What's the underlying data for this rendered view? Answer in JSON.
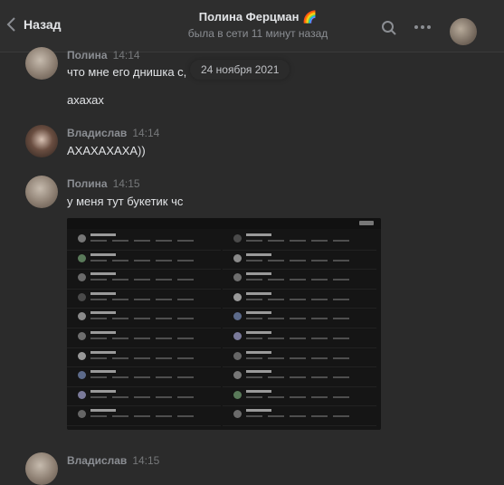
{
  "header": {
    "back_label": "Назад",
    "title": "Полина Ферцман 🌈",
    "status": "была в сети 11 минут назад"
  },
  "date_divider": "24 ноября 2021",
  "messages": [
    {
      "author": "Полина",
      "time": "14:14",
      "lines": [
        "что мне его днишка с,",
        "ахахах"
      ]
    },
    {
      "author": "Владислав",
      "time": "14:14",
      "lines": [
        "АХАХАХАХА))"
      ]
    },
    {
      "author": "Полина",
      "time": "14:15",
      "lines": [
        "у меня тут букетик чс"
      ],
      "attachment": "screenshot-image"
    },
    {
      "author": "Владислав",
      "time": "14:15",
      "lines": []
    }
  ],
  "icons": [
    "chevron-left-icon",
    "search-icon",
    "more-icon"
  ]
}
